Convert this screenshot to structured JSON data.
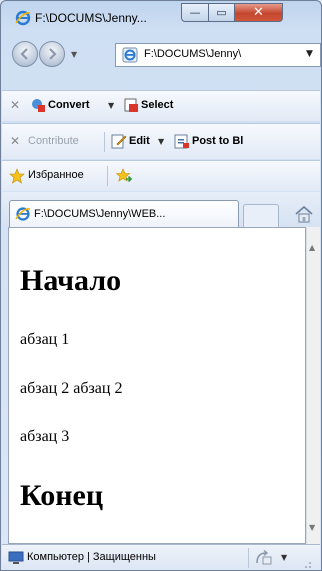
{
  "window": {
    "title": "F:\\DOCUMS\\Jenny...",
    "controls": {
      "minimize": "—",
      "maximize": "▭",
      "close": "✕"
    }
  },
  "nav": {
    "back_icon": "back-arrow-icon",
    "forward_icon": "forward-arrow-icon",
    "address": "F:\\DOCUMS\\Jenny\\"
  },
  "toolbar1": {
    "convert": "Convert",
    "select": "Select"
  },
  "toolbar2": {
    "contribute": "Contribute",
    "edit": "Edit",
    "post": "Post to Bl"
  },
  "favorites": {
    "label": "Избранное"
  },
  "tabs": {
    "active": "F:\\DOCUMS\\Jenny\\WEB..."
  },
  "page": {
    "heading1": "Начало",
    "p1": "абзац 1",
    "p2": "абзац 2 абзац 2",
    "p3": "абзац 3",
    "heading2": "Конец"
  },
  "status": {
    "zone": "Компьютер | Защищенны"
  },
  "colors": {
    "close_button": "#c4462f",
    "frame": "#bfd4ee"
  }
}
